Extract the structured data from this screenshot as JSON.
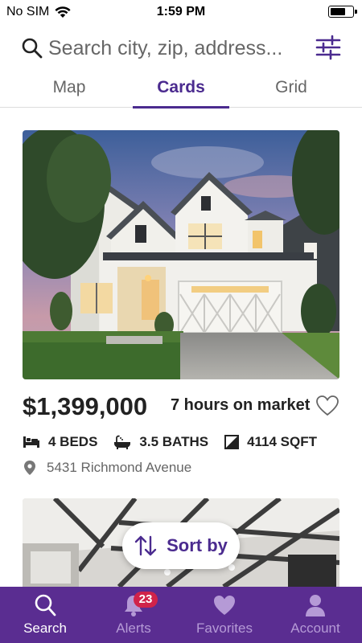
{
  "status_bar": {
    "carrier": "No SIM",
    "time": "1:59 PM",
    "battery_level": 0.7
  },
  "search": {
    "placeholder": "Search city, zip, address..."
  },
  "tabs": [
    {
      "label": "Map",
      "active": false
    },
    {
      "label": "Cards",
      "active": true
    },
    {
      "label": "Grid",
      "active": false
    }
  ],
  "listing": {
    "price": "$1,399,000",
    "time_on_market": "7 hours on market",
    "beds": "4 BEDS",
    "baths": "3.5 BATHS",
    "sqft": "4114 SQFT",
    "address": "5431 Richmond Avenue",
    "favorited": false
  },
  "sort_button": {
    "label": "Sort by"
  },
  "tabbar": {
    "items": [
      {
        "label": "Search",
        "icon": "search-icon",
        "active": true
      },
      {
        "label": "Alerts",
        "icon": "bell-icon",
        "active": false,
        "badge": "23"
      },
      {
        "label": "Favorites",
        "icon": "heart-icon",
        "active": false
      },
      {
        "label": "Account",
        "icon": "person-icon",
        "active": false
      }
    ]
  },
  "colors": {
    "brand": "#5a2d91",
    "accent": "#4b2b8f",
    "badge": "#d0234a"
  }
}
